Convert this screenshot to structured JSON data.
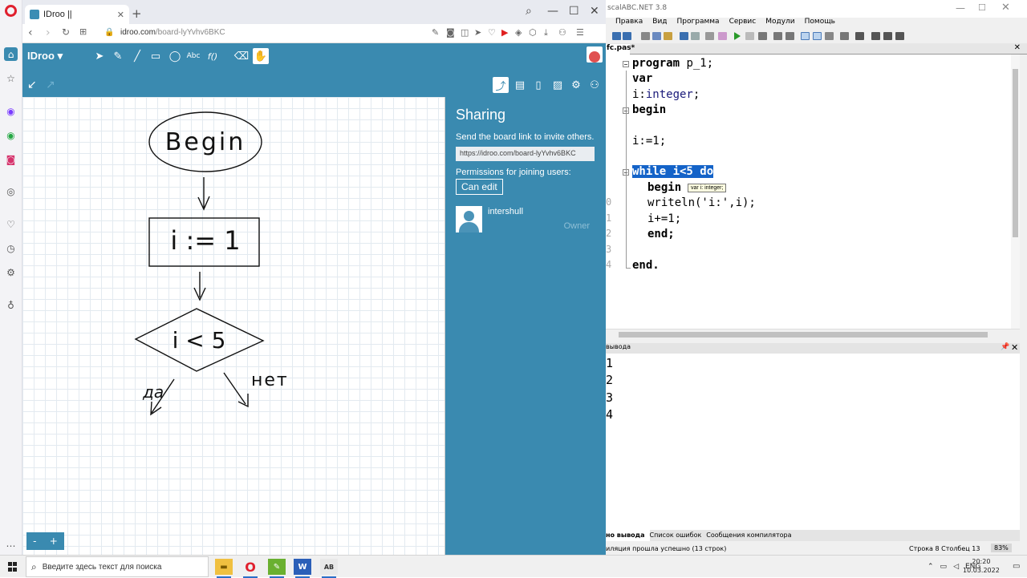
{
  "browser": {
    "tab_title": "IDroo ||",
    "tab_close": "✕",
    "new_tab": "+",
    "url_host": "idroo.com",
    "url_path": "/board-lyYvhv6BKC",
    "win_search": "⌕",
    "win_minimize": "—",
    "win_maximize": "☐",
    "win_close": "✕"
  },
  "idroo": {
    "logo": "IDroo",
    "logo_caret": "▾",
    "tools": {
      "text": "Abc",
      "formula": "f()"
    },
    "zoom_minus": "-",
    "zoom_plus": "+"
  },
  "sharing": {
    "title": "Sharing",
    "note": "Send the board link to invite others.",
    "link": "https://idroo.com/board-lyYvhv6BKC",
    "permissions_label": "Permissions for joining users:",
    "permission_button": "Can edit",
    "user_name": "intershull",
    "user_role": "Owner"
  },
  "whiteboard": {
    "begin": "Begin",
    "assign": "i := 1",
    "condition": "i < 5",
    "yes": "да",
    "no": "нет"
  },
  "pascal": {
    "title": "scalABC.NET 3.8",
    "menu": [
      "Правка",
      "Вид",
      "Программа",
      "Сервис",
      "Модули",
      "Помощь"
    ],
    "file_tab": "fc.pas*",
    "file_close": "✕",
    "line_numbers": [
      "0",
      "1",
      "2",
      "3",
      "4"
    ],
    "code": {
      "l1_kw": "program",
      "l1_rest": " p_1;",
      "l2": "var",
      "l3_a": "i:",
      "l3_b": "integer",
      "l3_c": ";",
      "l4": "begin",
      "l6": "i:=1;",
      "l8": "while i<5 do",
      "l9": "begin",
      "l10": "writeln('i:',i);",
      "l11": "i+=1;",
      "l12": "end;",
      "l14": "end."
    },
    "tooltip": "var i: integer;",
    "output_title": "вывода",
    "output_pin": "📌",
    "output_close": "✕",
    "output": [
      "1",
      "2",
      "3",
      "4"
    ],
    "bottom_tabs": [
      "но вывода",
      "Список ошибок",
      "Сообщения компилятора"
    ],
    "status_msg": "иляция прошла успешно (13 строк)",
    "status_pos": "Строка  8   Столбец  13",
    "status_zoom": "83%"
  },
  "taskbar": {
    "search_placeholder": "Введите здесь текст для поиска",
    "lang": "ENG",
    "time": "20:20",
    "date": "10.03.2022"
  }
}
